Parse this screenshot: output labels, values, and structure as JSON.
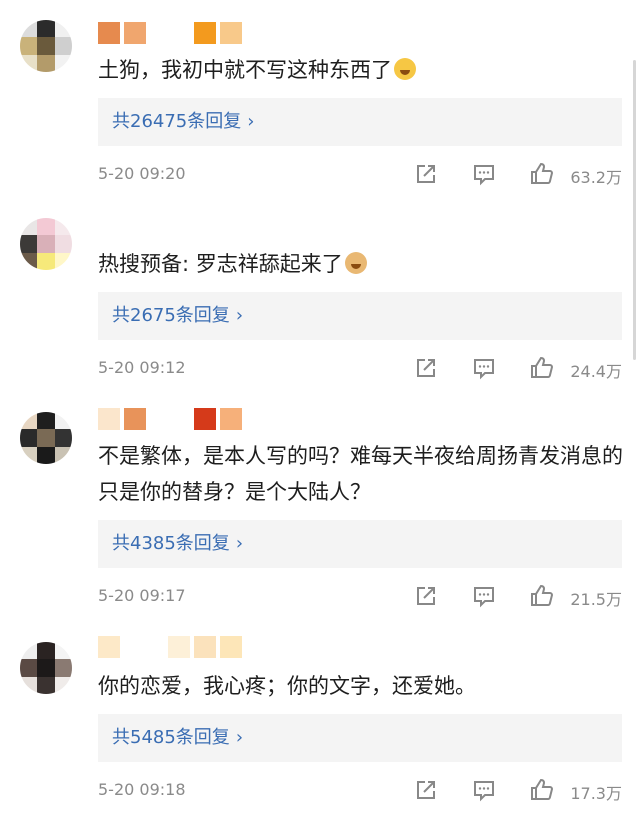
{
  "colors": {
    "link": "#3a6db3",
    "meta": "#8a8a8a",
    "reply_bg": "#f4f4f4"
  },
  "comments": [
    {
      "text": "土狗，我初中就不写这种东西了",
      "emoji": "laughing-crying-emoji",
      "reply": "共26475条回复",
      "chevron": "›",
      "time": "5-20 09:20",
      "likes": "63.2万"
    },
    {
      "text": "热搜预备: 罗志祥舔起来了",
      "emoji": "doge-emoji",
      "reply": "共2675条回复",
      "chevron": "›",
      "time": "5-20 09:12",
      "likes": "24.4万"
    },
    {
      "text": "不是繁体，是本人写的吗？难每天半夜给周扬青发消息的只是你的替身？是个大陆人？",
      "reply": "共4385条回复",
      "chevron": "›",
      "time": "5-20 09:17",
      "likes": "21.5万"
    },
    {
      "text": "你的恋爱，我心疼；你的文字，还爱她。",
      "reply": "共5485条回复",
      "chevron": "›",
      "time": "5-20 09:18",
      "likes": "17.3万"
    }
  ]
}
